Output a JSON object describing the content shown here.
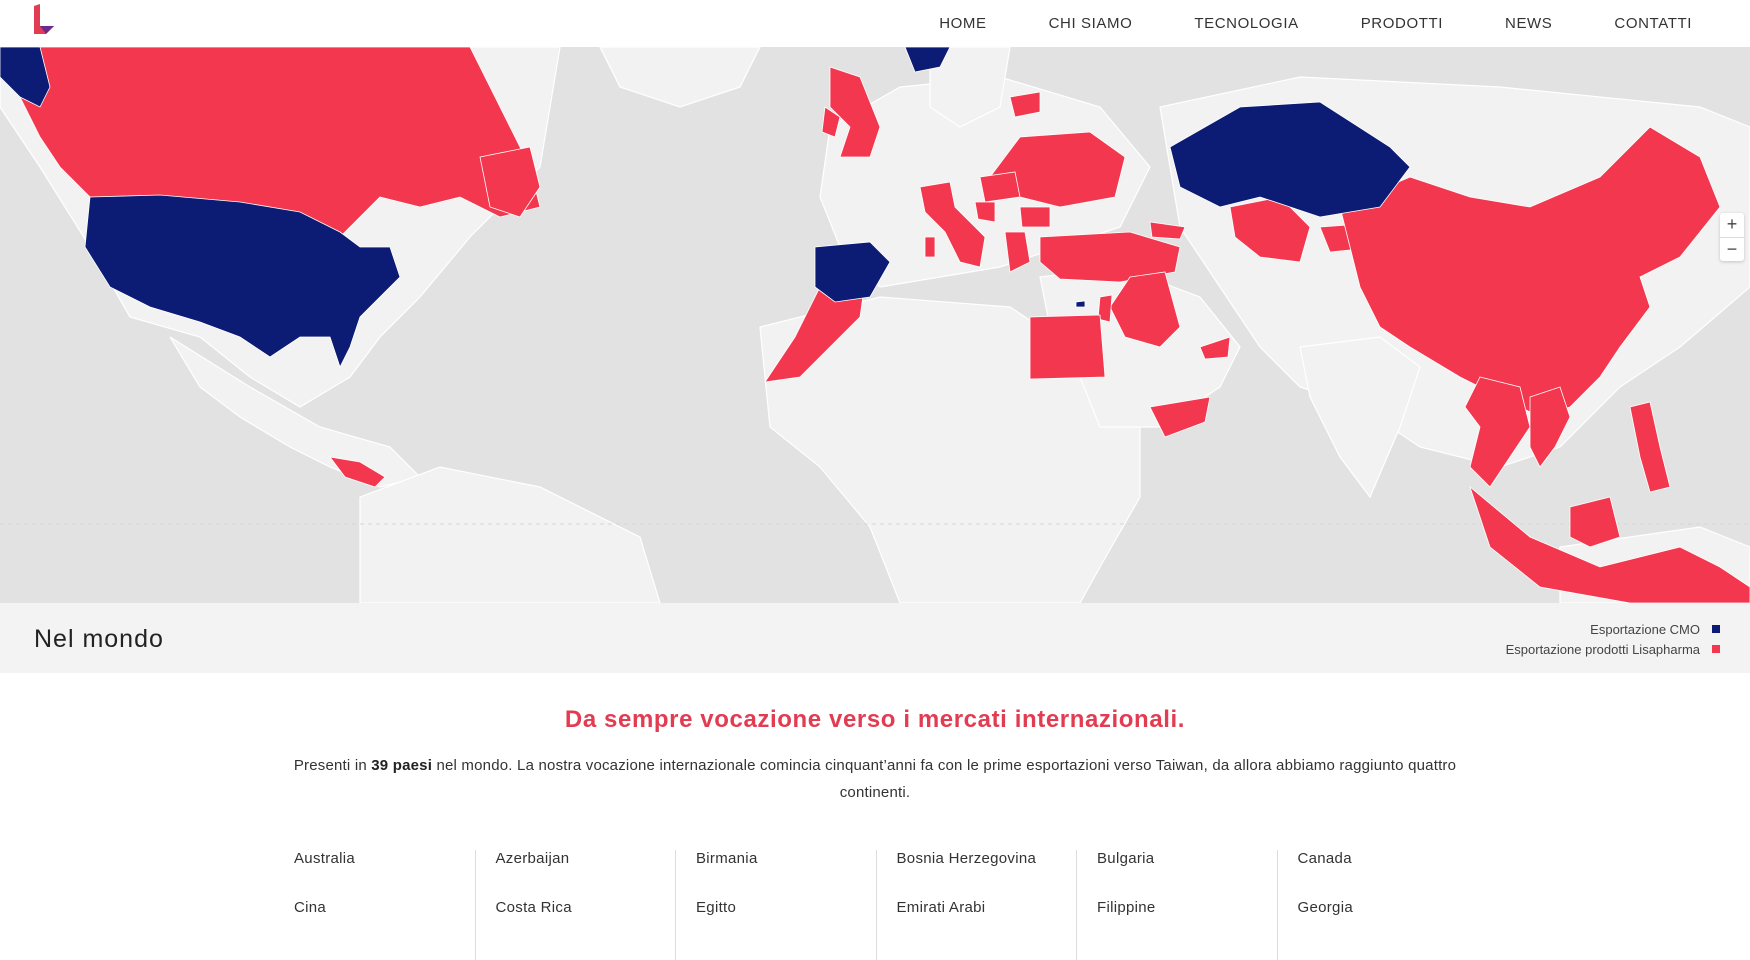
{
  "nav": {
    "items": [
      "HOME",
      "CHI SIAMO",
      "TECNOLOGIA",
      "PRODOTTI",
      "NEWS",
      "CONTATTI"
    ]
  },
  "map": {
    "zoom_in": "+",
    "zoom_out": "−",
    "colors": {
      "ocean": "#e2e2e2",
      "land": "#f2f2f2",
      "cmo": "#0c1b73",
      "products": "#f2374f"
    }
  },
  "band": {
    "title": "Nel mondo",
    "legend": [
      {
        "label": "Esportazione CMO",
        "color": "#0c1b73"
      },
      {
        "label": "Esportazione prodotti Lisapharma",
        "color": "#f2374f"
      }
    ]
  },
  "section": {
    "headline": "Da sempre vocazione verso i mercati internazionali.",
    "intro_before": "Presenti in ",
    "intro_bold": "39 paesi",
    "intro_after": " nel mondo. La nostra vocazione internazionale comincia cinquant’anni fa con le prime esportazioni verso Taiwan, da allora abbiamo raggiunto quattro continenti."
  },
  "countries": [
    [
      "Australia",
      "Cina"
    ],
    [
      "Azerbaijan",
      "Costa Rica"
    ],
    [
      "Birmania",
      "Egitto"
    ],
    [
      "Bosnia Herzegovina",
      "Emirati Arabi"
    ],
    [
      "Bulgaria",
      "Filippine"
    ],
    [
      "Canada",
      "Georgia"
    ]
  ]
}
